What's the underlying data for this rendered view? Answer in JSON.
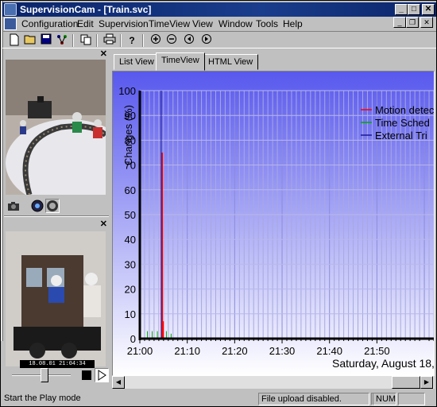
{
  "window": {
    "title": "SupervisionCam - [Train.svc]"
  },
  "menu": {
    "items": [
      "Configuration",
      "Edit",
      "Supervision",
      "TimeView",
      "View",
      "Window",
      "Tools",
      "Help"
    ]
  },
  "tabs": [
    {
      "label": "List View",
      "active": false
    },
    {
      "label": "TimeView",
      "active": true
    },
    {
      "label": "HTML View",
      "active": false
    }
  ],
  "player": {
    "timestamp": "18.08.01 21:04:34"
  },
  "colors": {
    "motion": "#ff0000",
    "schedule": "#00aa00",
    "trigger": "#1a1a99",
    "plot_top": "#5858ee",
    "plot_bottom": "#ffffff"
  },
  "chart_data": {
    "type": "line",
    "ylabel": "Changes (%)",
    "ylim": [
      0,
      100
    ],
    "yticks": [
      0,
      10,
      20,
      30,
      40,
      50,
      60,
      70,
      80,
      90,
      100
    ],
    "xticks": [
      "21:00",
      "21:10",
      "21:20",
      "21:30",
      "21:40",
      "21:50"
    ],
    "xlim_minutes": [
      0,
      62
    ],
    "date_label": "Saturday, August 18,",
    "legend": {
      "position": "top-right",
      "entries": [
        "Motion detec",
        "Time Sched",
        "External Tri"
      ]
    },
    "series": [
      {
        "name": "Motion detec",
        "color": "#ff0000",
        "spikes": [
          {
            "minute": 4.7,
            "value": 75
          },
          {
            "minute": 4.9,
            "value": 7
          }
        ]
      },
      {
        "name": "Time Sched",
        "color": "#00aa00",
        "spikes": [
          {
            "minute": 1.6,
            "value": 3
          },
          {
            "minute": 2.6,
            "value": 3
          },
          {
            "minute": 3.7,
            "value": 3
          },
          {
            "minute": 5.6,
            "value": 3
          },
          {
            "minute": 6.6,
            "value": 2
          }
        ]
      },
      {
        "name": "External Tri",
        "color": "#1a1a99",
        "spikes": [
          {
            "minute": 4.5,
            "value": 100
          }
        ]
      }
    ]
  },
  "status": {
    "message": "Start the Play mode",
    "upload": "File upload disabled.",
    "num": "NUM"
  }
}
